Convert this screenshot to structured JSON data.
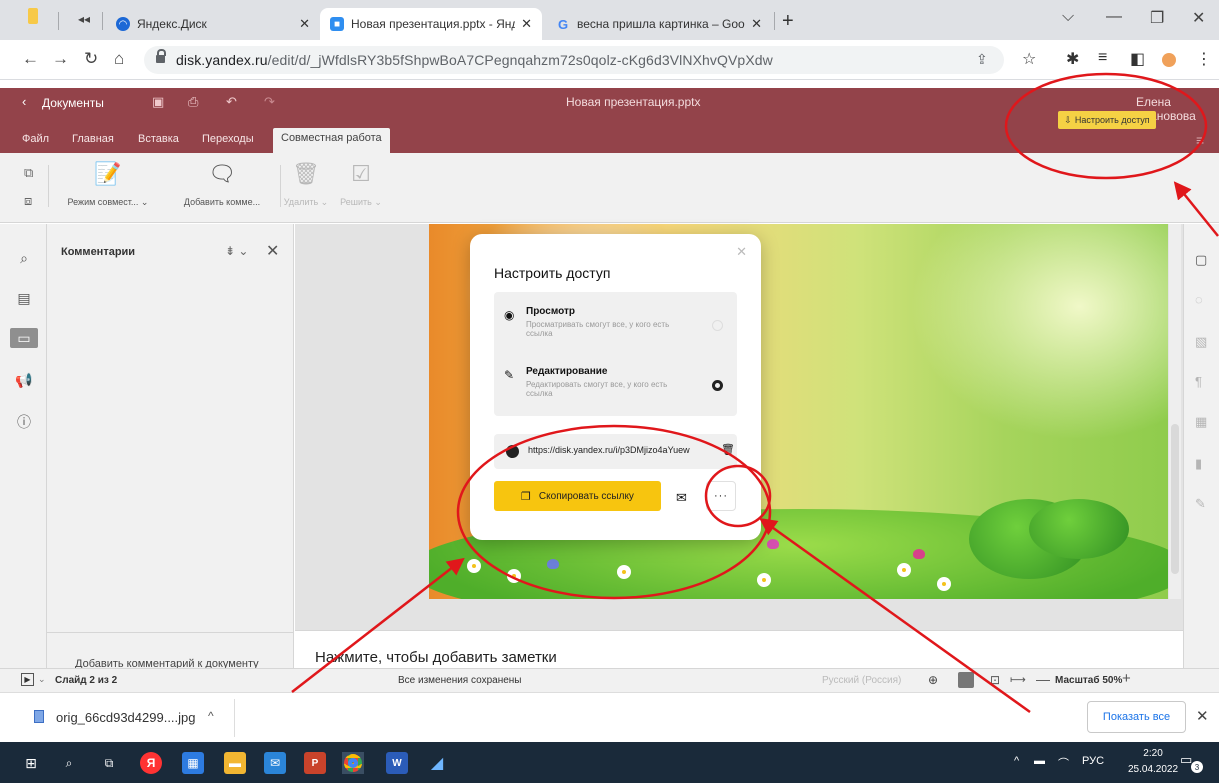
{
  "browser": {
    "tabs": [
      {
        "title": "",
        "favicon": "back-icon"
      },
      {
        "title": "Яндекс.Диск"
      },
      {
        "title": "Новая презентация.pptx - Янде",
        "active": true
      },
      {
        "title": "весна пришла картинка – Goog"
      }
    ],
    "new_tab": "+",
    "controls": {
      "dropdown": "⌵",
      "minimize": "—",
      "restore": "❐",
      "close": "✕"
    },
    "address": {
      "host": "disk.yandex.ru",
      "path": "/edit/d/_jWfdlsRY3b5fShpwBoA7CPegnqahzm72s0qolz-cKg6d3VlNXhvQVpXdw"
    }
  },
  "editor": {
    "app_name": "Документы",
    "doc_title": "Новая презентация.pptx",
    "user_name": "Елена Становова",
    "share_button": "Настроить доступ",
    "menu": [
      "Файл",
      "Главная",
      "Вставка",
      "Переходы",
      "Совместная работа"
    ],
    "toolbar": {
      "co_edit": "Режим совмест...",
      "add_comment": "Добавить комме...",
      "delete": "Удалить",
      "resolve": "Решить"
    },
    "comments": {
      "title": "Комментарии",
      "add_doc_comment": "Добавить комментарий к документу"
    },
    "notes_placeholder": "Нажмите, чтобы добавить заметки",
    "status": {
      "slide": "Слайд 2 из 2",
      "saved": "Все изменения сохранены",
      "language": "Русский (Россия)",
      "zoom": "Масштаб 50%"
    }
  },
  "share_modal": {
    "title": "Настроить доступ",
    "view": {
      "name": "Просмотр",
      "desc": "Просматривать смогут все, у кого есть ссылка"
    },
    "edit": {
      "name": "Редактирование",
      "desc": "Редактировать смогут все, у кого есть ссылка"
    },
    "link": "https://disk.yandex.ru/i/p3DMjizo4aYuew",
    "copy_button": "Скопировать ссылку",
    "more": "···",
    "selected": "edit"
  },
  "downloads": {
    "file": "orig_66cd93d4299....jpg",
    "show_all": "Показать все"
  },
  "taskbar": {
    "lang": "РУС",
    "time": "2:20",
    "date": "25.04.2022",
    "notifications": "3"
  },
  "colors": {
    "editor_header": "#93434a",
    "share_yellow": "#f5d144",
    "annotation_red": "#e0171b"
  }
}
